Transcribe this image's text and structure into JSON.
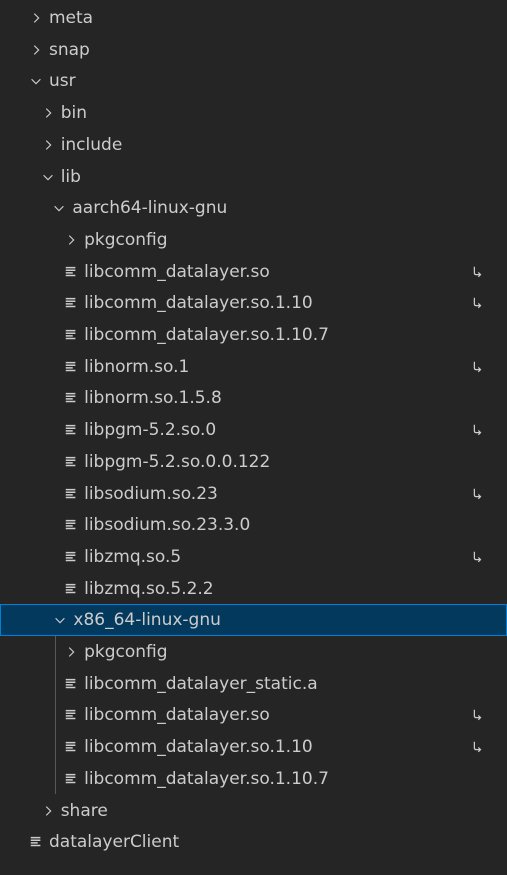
{
  "explorer": {
    "items": [
      {
        "label": "meta",
        "kind": "folder",
        "expanded": false,
        "depth": 0,
        "symlink": false
      },
      {
        "label": "snap",
        "kind": "folder",
        "expanded": false,
        "depth": 0,
        "symlink": false
      },
      {
        "label": "usr",
        "kind": "folder",
        "expanded": true,
        "depth": 0,
        "symlink": false
      },
      {
        "label": "bin",
        "kind": "folder",
        "expanded": false,
        "depth": 1,
        "symlink": false
      },
      {
        "label": "include",
        "kind": "folder",
        "expanded": false,
        "depth": 1,
        "symlink": false
      },
      {
        "label": "lib",
        "kind": "folder",
        "expanded": true,
        "depth": 1,
        "symlink": false
      },
      {
        "label": "aarch64-linux-gnu",
        "kind": "folder",
        "expanded": true,
        "depth": 2,
        "symlink": false
      },
      {
        "label": "pkgconfig",
        "kind": "folder",
        "expanded": false,
        "depth": 3,
        "symlink": false
      },
      {
        "label": "libcomm_datalayer.so",
        "kind": "file",
        "depth": 3,
        "symlink": true
      },
      {
        "label": "libcomm_datalayer.so.1.10",
        "kind": "file",
        "depth": 3,
        "symlink": true
      },
      {
        "label": "libcomm_datalayer.so.1.10.7",
        "kind": "file",
        "depth": 3,
        "symlink": false
      },
      {
        "label": "libnorm.so.1",
        "kind": "file",
        "depth": 3,
        "symlink": true
      },
      {
        "label": "libnorm.so.1.5.8",
        "kind": "file",
        "depth": 3,
        "symlink": false
      },
      {
        "label": "libpgm-5.2.so.0",
        "kind": "file",
        "depth": 3,
        "symlink": true
      },
      {
        "label": "libpgm-5.2.so.0.0.122",
        "kind": "file",
        "depth": 3,
        "symlink": false
      },
      {
        "label": "libsodium.so.23",
        "kind": "file",
        "depth": 3,
        "symlink": true
      },
      {
        "label": "libsodium.so.23.3.0",
        "kind": "file",
        "depth": 3,
        "symlink": false
      },
      {
        "label": "libzmq.so.5",
        "kind": "file",
        "depth": 3,
        "symlink": true
      },
      {
        "label": "libzmq.so.5.2.2",
        "kind": "file",
        "depth": 3,
        "symlink": false
      },
      {
        "label": "x86_64-linux-gnu",
        "kind": "folder",
        "expanded": true,
        "depth": 2,
        "symlink": false,
        "selected": true
      },
      {
        "label": "pkgconfig",
        "kind": "folder",
        "expanded": false,
        "depth": 3,
        "symlink": false
      },
      {
        "label": "libcomm_datalayer_static.a",
        "kind": "file",
        "depth": 3,
        "symlink": false
      },
      {
        "label": "libcomm_datalayer.so",
        "kind": "file",
        "depth": 3,
        "symlink": true
      },
      {
        "label": "libcomm_datalayer.so.1.10",
        "kind": "file",
        "depth": 3,
        "symlink": true
      },
      {
        "label": "libcomm_datalayer.so.1.10.7",
        "kind": "file",
        "depth": 3,
        "symlink": false
      },
      {
        "label": "share",
        "kind": "folder",
        "expanded": false,
        "depth": 1,
        "symlink": false
      },
      {
        "label": "datalayerClient",
        "kind": "file",
        "depth": 0,
        "symlink": false
      }
    ]
  },
  "colors": {
    "background": "#252526",
    "text": "#cccccc",
    "selected_bg": "#04395e",
    "selected_border": "#007fd4",
    "indent_guide": "#585858"
  }
}
